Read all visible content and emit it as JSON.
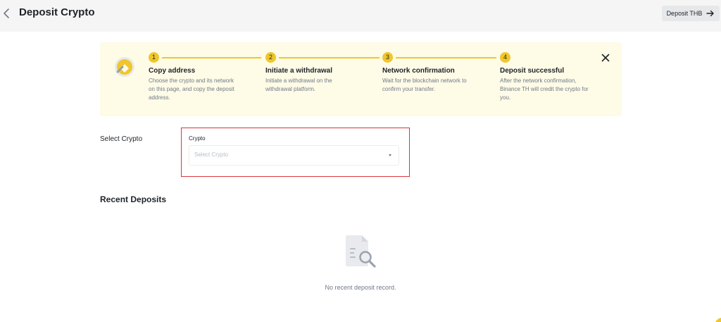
{
  "header": {
    "title": "Deposit Crypto",
    "deposit_thb_label": "Deposit THB"
  },
  "banner": {
    "steps": [
      {
        "number": "1",
        "title": "Copy address",
        "description": "Choose the crypto and its network on this page, and copy the deposit address."
      },
      {
        "number": "2",
        "title": "Initiate a withdrawal",
        "description": "Initiate a withdrawal on the withdrawal platform."
      },
      {
        "number": "3",
        "title": "Network confirmation",
        "description": "Wait for the blockchain network to confirm your transfer."
      },
      {
        "number": "4",
        "title": "Deposit successful",
        "description": "After the network confirmation, Binance TH will credit the crypto for you."
      }
    ]
  },
  "select_crypto": {
    "section_label": "Select Crypto",
    "field_label": "Crypto",
    "placeholder": "Select Crypto"
  },
  "recent_deposits": {
    "title": "Recent Deposits",
    "empty_text": "No recent deposit record."
  },
  "colors": {
    "accent": "#f0c62a",
    "banner_bg": "#fefbe6",
    "highlight_border": "#d9363e",
    "topbar_bg": "#f5f5f5"
  },
  "icons": {
    "back": "chevron-left-icon",
    "forward": "arrow-right-icon",
    "close": "close-icon",
    "banner_logo": "coin-logo-icon",
    "empty_state": "document-search-icon",
    "dropdown": "caret-down-icon"
  }
}
